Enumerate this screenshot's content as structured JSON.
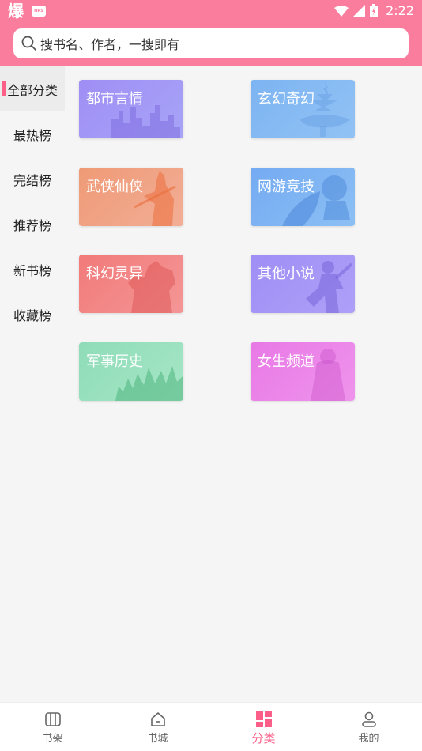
{
  "status_bar": {
    "app_glyph": "爆",
    "notification_badge": "HRS",
    "time": "2:22"
  },
  "search": {
    "placeholder": "搜书名、作者，一搜即有"
  },
  "sidebar": {
    "items": [
      {
        "label": "全部分类",
        "active": true
      },
      {
        "label": "最热榜",
        "active": false
      },
      {
        "label": "完结榜",
        "active": false
      },
      {
        "label": "推荐榜",
        "active": false
      },
      {
        "label": "新书榜",
        "active": false
      },
      {
        "label": "收藏榜",
        "active": false
      }
    ]
  },
  "categories": [
    {
      "label": "都市言情",
      "icon": "city-skyline-icon",
      "color_start": "#9f8ef5",
      "color_end": "#a7a4f6"
    },
    {
      "label": "玄幻奇幻",
      "icon": "floating-pagoda-icon",
      "color_start": "#7cb4f2",
      "color_end": "#92c2f4"
    },
    {
      "label": "武侠仙侠",
      "icon": "swordsman-icon",
      "color_start": "#ef9a76",
      "color_end": "#f2ae96"
    },
    {
      "label": "网游竞技",
      "icon": "game-character-icon",
      "color_start": "#74aaf2",
      "color_end": "#8cc0f4"
    },
    {
      "label": "科幻灵异",
      "icon": "warrior-silhouette-icon",
      "color_start": "#f27a7a",
      "color_end": "#f49696"
    },
    {
      "label": "其他小说",
      "icon": "dancer-silhouette-icon",
      "color_start": "#9f8ef5",
      "color_end": "#aea0f8"
    },
    {
      "label": "军事历史",
      "icon": "army-silhouette-icon",
      "color_start": "#8fdcb8",
      "color_end": "#a6e6c6"
    },
    {
      "label": "女生频道",
      "icon": "girl-silhouette-icon",
      "color_start": "#e879e6",
      "color_end": "#ef94ec"
    }
  ],
  "tabbar": {
    "items": [
      {
        "label": "书架",
        "icon": "bookshelf-icon",
        "active": false
      },
      {
        "label": "书城",
        "icon": "home-icon",
        "active": false
      },
      {
        "label": "分类",
        "icon": "category-grid-icon",
        "active": true
      },
      {
        "label": "我的",
        "icon": "profile-icon",
        "active": false
      }
    ]
  },
  "colors": {
    "accent": "#fb7d9d",
    "active_accent": "#fb5f87"
  }
}
